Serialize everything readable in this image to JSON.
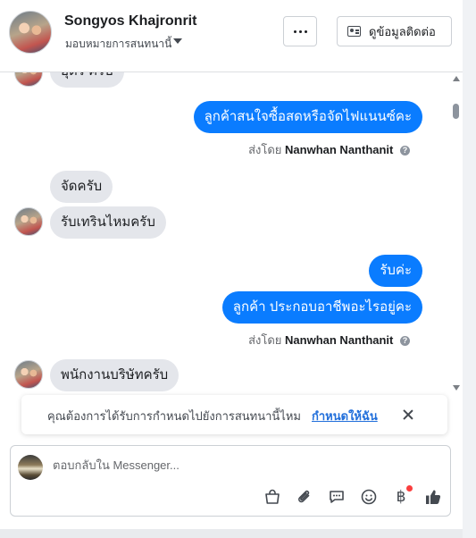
{
  "header": {
    "contact_name": "Songyos Khajronrit",
    "assign_label": "มอบหมายการสนทนานี้",
    "more_label": "···",
    "details_label": "ดูข้อมูลติดต่อ"
  },
  "messages": {
    "partial_top": "อุดร ครับ",
    "out_1": "ลูกค้าสนใจซื้อสดหรือจัดไฟแนนซ์คะ",
    "sent_by_prefix_1": "ส่งโดย",
    "sent_by_name_1": "Nanwhan Nanthanit",
    "in_1": "จัดครับ",
    "in_2": "รับเทรินไหมครับ",
    "out_2": "รับค่ะ",
    "out_3": "ลูกค้า ประกอบอาชีพอะไรอยู่คะ",
    "sent_by_prefix_2": "ส่งโดย",
    "sent_by_name_2": "Nanwhan Nanthanit",
    "in_3": "พนักงานบริษัทครับ"
  },
  "banner": {
    "text": "คุณต้องการได้รับการกำหนดไปยังการสนทนานี้ไหม",
    "link": "กำหนดให้ฉัน"
  },
  "composer": {
    "placeholder": "ตอบกลับใน Messenger...",
    "baht_symbol": "฿"
  },
  "colors": {
    "outgoing_bubble": "#0a7cff",
    "incoming_bubble": "#e4e6eb",
    "link": "#216fdb",
    "like_icon": "#444950",
    "notification_dot": "#fa3e3e"
  }
}
